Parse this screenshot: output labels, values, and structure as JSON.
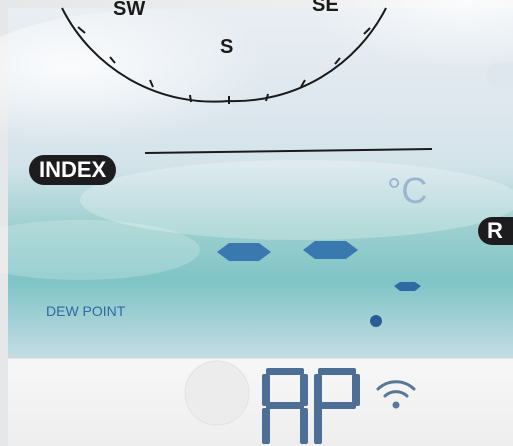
{
  "compass": {
    "direction_labels": [
      "SW",
      "S",
      "SE"
    ]
  },
  "index_label": "INDEX",
  "unit_label": "°C",
  "right_label_fragment": "R",
  "dew_point_label": "DEW POINT",
  "lower_display": {
    "characters": "AP",
    "wifi": "wifi-icon"
  },
  "colors": {
    "lcd_blue": "#2f6aa3",
    "faint_blue": "#9ab5cf",
    "pill": "#1d1d1f",
    "teal_band": "#7fc4c6"
  }
}
